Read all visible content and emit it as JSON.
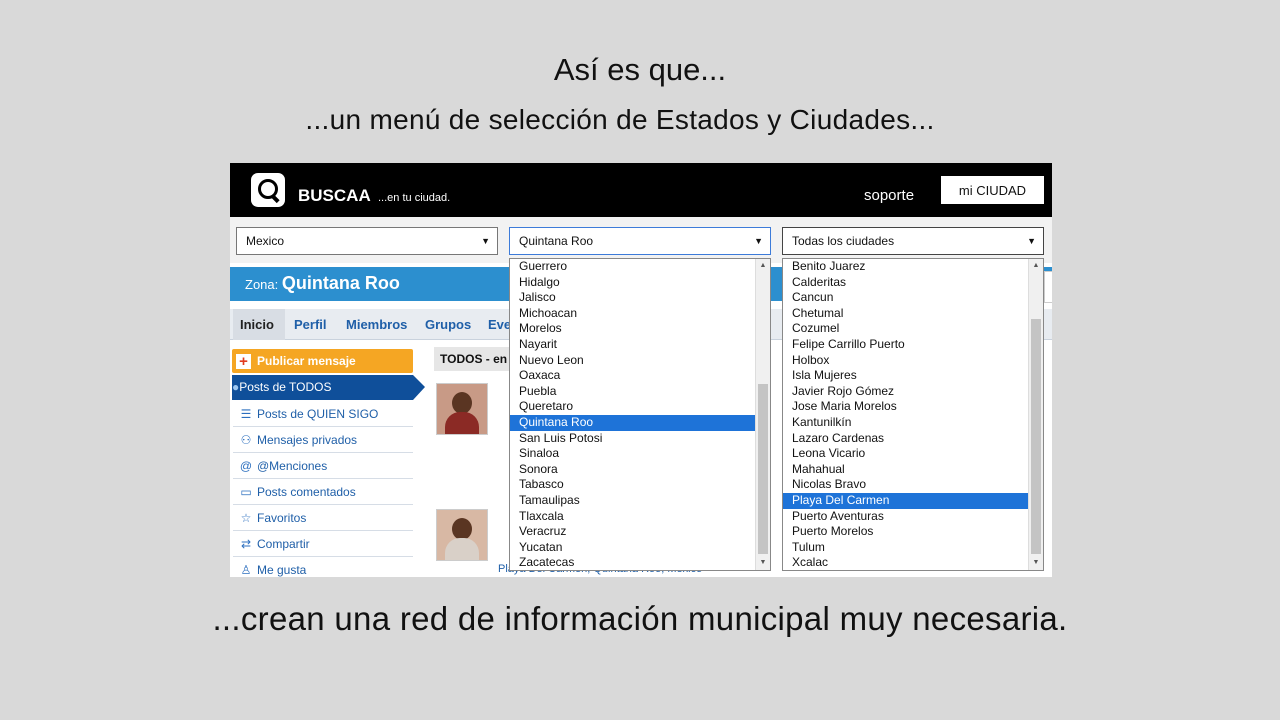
{
  "slide": {
    "title": "Así es que...",
    "subtitle": "...un menú de selección de Estados y Ciudades...",
    "caption": "...crean una red de información municipal muy necesaria."
  },
  "header": {
    "brand": "BUSCAA",
    "tagline": "...en tu ciudad.",
    "support_link": "soporte",
    "city_button": "mi CIUDAD"
  },
  "selects": {
    "country": "Mexico",
    "state": "Quintana Roo",
    "city": "Todas los ciudades"
  },
  "zone": {
    "label": "Zona:",
    "name": "Quintana Roo"
  },
  "nav": [
    "Inicio",
    "Perfil",
    "Miembros",
    "Grupos",
    "Eve"
  ],
  "sidebar": {
    "publish": "Publicar mensaje",
    "items": [
      {
        "label": "Posts de TODOS",
        "icon": "globe-icon"
      },
      {
        "label": "Posts de QUIEN SIGO",
        "icon": "list-icon"
      },
      {
        "label": "Mensajes privados",
        "icon": "users-icon"
      },
      {
        "label": "@Menciones",
        "icon": "at-icon"
      },
      {
        "label": "Posts comentados",
        "icon": "comment-icon"
      },
      {
        "label": "Favoritos",
        "icon": "star-icon"
      },
      {
        "label": "Compartir",
        "icon": "retweet-icon"
      },
      {
        "label": "Me gusta",
        "icon": "thumbs-up-icon"
      }
    ]
  },
  "feed": {
    "header": "TODOS - en",
    "post_location": "Playa Del Carmen, Quintana Roo, Mexico"
  },
  "state_options": [
    "Guerrero",
    "Hidalgo",
    "Jalisco",
    "Michoacan",
    "Morelos",
    "Nayarit",
    "Nuevo Leon",
    "Oaxaca",
    "Puebla",
    "Queretaro",
    "Quintana Roo",
    "San Luis Potosi",
    "Sinaloa",
    "Sonora",
    "Tabasco",
    "Tamaulipas",
    "Tlaxcala",
    "Veracruz",
    "Yucatan",
    "Zacatecas"
  ],
  "state_selected": "Quintana Roo",
  "city_options": [
    "Benito Juarez",
    "Calderitas",
    "Cancun",
    "Chetumal",
    "Cozumel",
    "Felipe Carrillo Puerto",
    "Holbox",
    "Isla Mujeres",
    "Javier Rojo Gómez",
    "Jose Maria Morelos",
    "Kantunilkín",
    "Lazaro Cardenas",
    "Leona Vicario",
    "Mahahual",
    "Nicolas Bravo",
    "Playa Del Carmen",
    "Puerto Aventuras",
    "Puerto Morelos",
    "Tulum",
    "Xcalac"
  ],
  "city_selected": "Playa Del Carmen"
}
